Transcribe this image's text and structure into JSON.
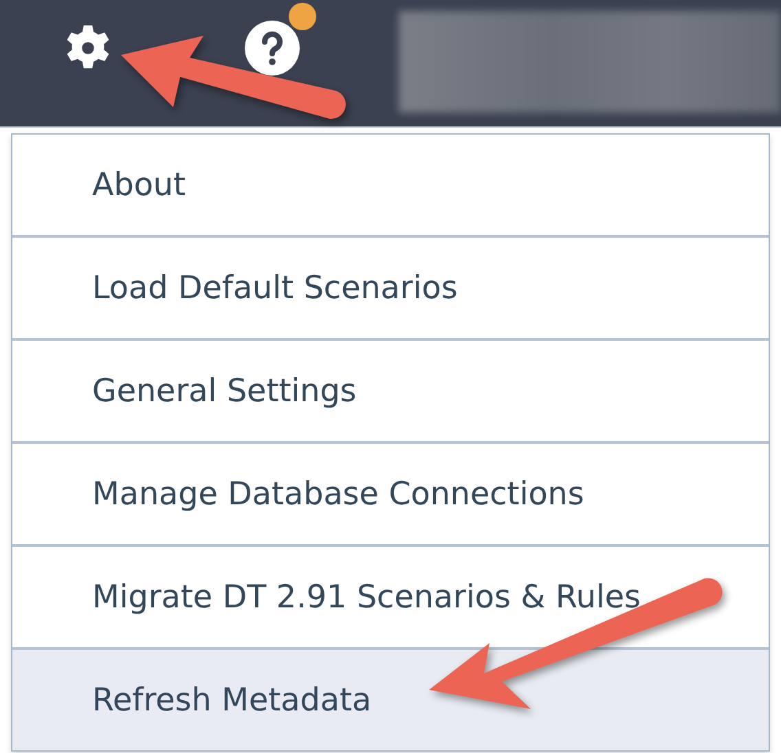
{
  "toolbar": {
    "help_badge": true
  },
  "menu": {
    "items": [
      {
        "label": "About",
        "selected": false
      },
      {
        "label": "Load Default Scenarios",
        "selected": false
      },
      {
        "label": "General Settings",
        "selected": false
      },
      {
        "label": "Manage Database Connections",
        "selected": false
      },
      {
        "label": "Migrate DT 2.91 Scenarios & Rules",
        "selected": false
      },
      {
        "label": "Refresh Metadata",
        "selected": true
      }
    ]
  }
}
